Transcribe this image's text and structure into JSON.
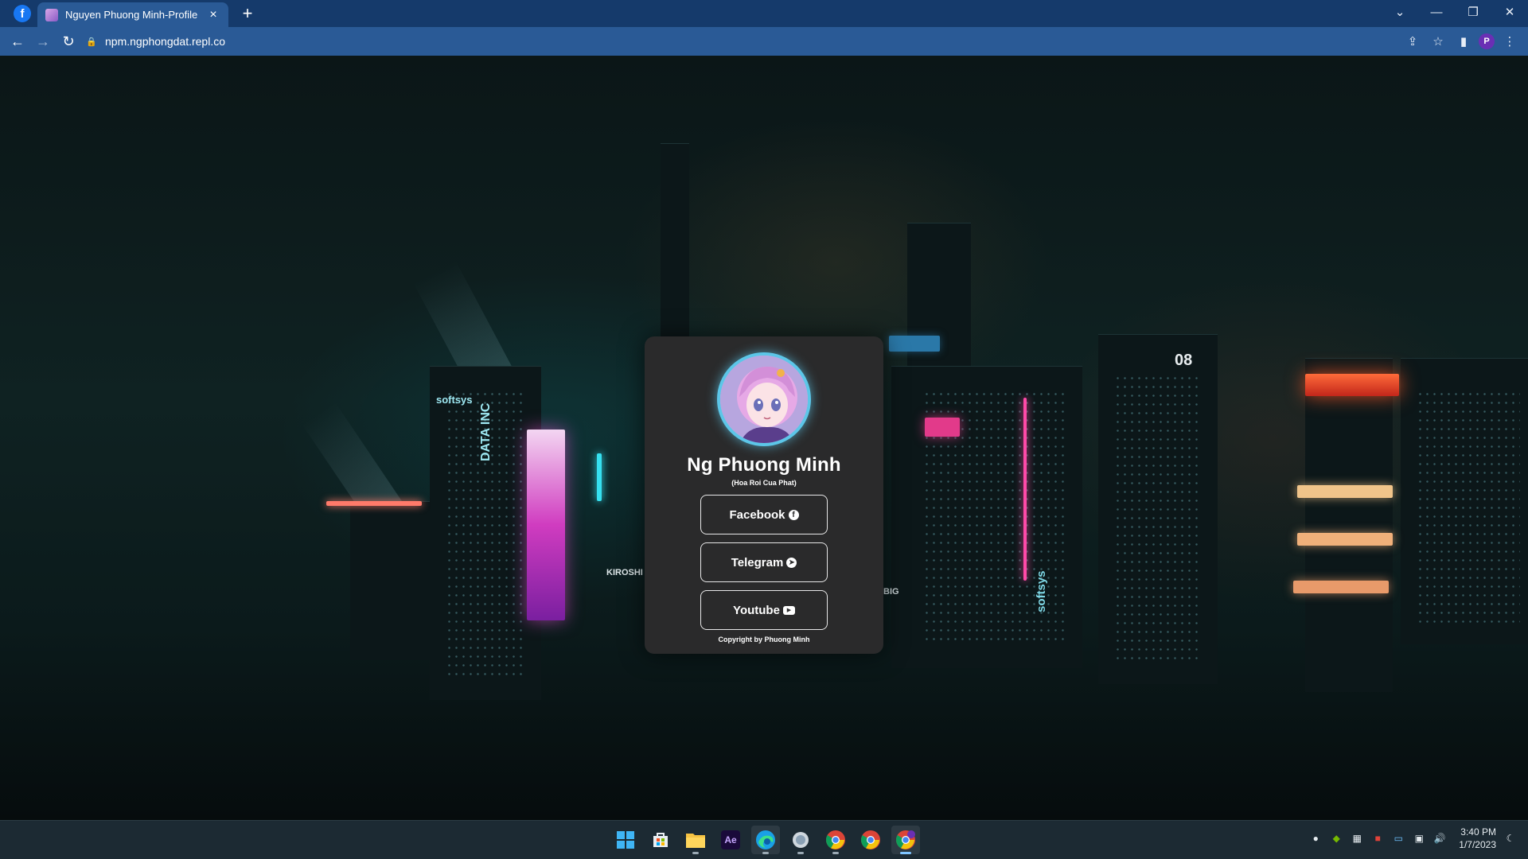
{
  "browser": {
    "tab_title": "Nguyen Phuong Minh-Profile",
    "url": "npm.ngphongdat.repl.co",
    "profile_initial": "P"
  },
  "profile": {
    "name": "Ng Phuong Minh",
    "tagline": "(Hoa Roi Cua Phat)",
    "links": [
      {
        "label": "Facebook",
        "icon": "facebook-icon"
      },
      {
        "label": "Telegram",
        "icon": "telegram-icon"
      },
      {
        "label": "Youtube",
        "icon": "youtube-icon"
      }
    ],
    "copyright": "Copyright by Phuong Minh"
  },
  "background": {
    "signs": [
      "softsys",
      "DATA INC",
      "KIROSHI",
      "08",
      "softsys",
      "BIG"
    ]
  },
  "taskbar": {
    "apps": [
      "start-icon",
      "store-icon",
      "file-explorer-icon",
      "after-effects-icon",
      "edge-icon",
      "app-icon",
      "chrome-icon",
      "chrome-icon",
      "chrome-profile-icon"
    ],
    "ae_label": "Ae",
    "time": "3:40 PM",
    "date": "1/7/2023"
  },
  "colors": {
    "titlebar": "#153a6b",
    "toolbar": "#2a5a96",
    "card": "#2a2a2b",
    "avatar_ring": "#5cc6e8"
  }
}
